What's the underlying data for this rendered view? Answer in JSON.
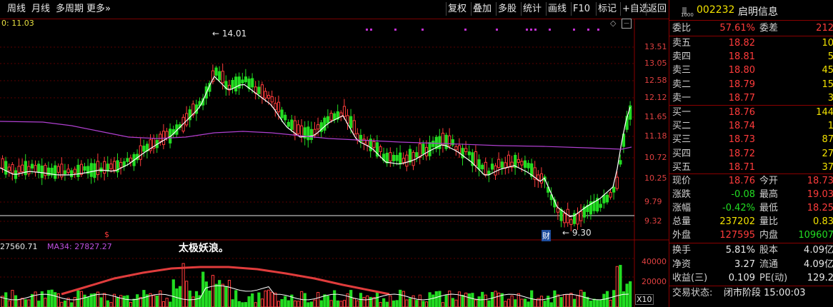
{
  "toolbar": {
    "left": [
      "周线",
      "月线",
      "多周期",
      "更多»"
    ],
    "right": [
      "复权",
      "叠加",
      "多股",
      "统计",
      "画线",
      "F10",
      "标记",
      "+自选",
      "返回"
    ]
  },
  "chart": {
    "top_left_label": "0: 11.03",
    "price_ticks": [
      "13.51",
      "13.05",
      "12.58",
      "12.12",
      "11.65",
      "11.18",
      "10.72",
      "10.25",
      "9.79",
      "9.32"
    ],
    "high_annotation": "14.01",
    "low_annotation": "9.30",
    "finance_marker": "财",
    "dollar_marker": "$",
    "volume_header": "27560.71",
    "ma34_label": "MA34: 27827.27",
    "note": "太极妖浪。",
    "volume_ticks": [
      "40000",
      "20000"
    ],
    "x_scale": "X10",
    "colors": {
      "up": "#ff3b3b",
      "down": "#22dd22",
      "ma_white": "#ffffff",
      "ma_purple": "#b040d0",
      "ma_red": "#e03c3c"
    }
  },
  "quote": {
    "code": "002232",
    "name": "启明信息",
    "weibi_label": "委比",
    "weibi_value": "57.61%",
    "weicha_label": "委差",
    "weicha_value": "212",
    "asks": [
      {
        "label": "卖五",
        "price": "18.82",
        "vol": "10"
      },
      {
        "label": "卖四",
        "price": "18.81",
        "vol": "5"
      },
      {
        "label": "卖三",
        "price": "18.80",
        "vol": "45"
      },
      {
        "label": "卖二",
        "price": "18.79",
        "vol": "15"
      },
      {
        "label": "卖一",
        "price": "18.77",
        "vol": "3"
      }
    ],
    "bids": [
      {
        "label": "买一",
        "price": "18.76",
        "vol": "144"
      },
      {
        "label": "买二",
        "price": "18.74",
        "vol": "1"
      },
      {
        "label": "买三",
        "price": "18.73",
        "vol": "87"
      },
      {
        "label": "买四",
        "price": "18.72",
        "vol": "27"
      },
      {
        "label": "买五",
        "price": "18.71",
        "vol": "37"
      }
    ],
    "stats": [
      {
        "l1": "现价",
        "v1": "18.76",
        "l2": "今开",
        "v2": "18.73"
      },
      {
        "l1": "涨跌",
        "v1": "-0.08",
        "l2": "最高",
        "v2": "19.03"
      },
      {
        "l1": "涨幅",
        "v1": "-0.42%",
        "l2": "最低",
        "v2": "18.25"
      },
      {
        "l1": "总量",
        "v1": "237202",
        "l2": "量比",
        "v2": "0.83"
      },
      {
        "l1": "外盘",
        "v1": "127595",
        "l2": "内盘",
        "v2": "109607"
      }
    ],
    "stats2": [
      {
        "l1": "换手",
        "v1": "5.81%",
        "l2": "股本",
        "v2": "4.09亿"
      },
      {
        "l1": "净资",
        "v1": "3.27",
        "l2": "流通",
        "v2": "4.09亿"
      },
      {
        "l1": "收益(三)",
        "v1": "0.109",
        "l2": "PE(动)",
        "v2": "129.2"
      }
    ],
    "trade_status_label": "交易状态:",
    "trade_status_value": "闭市阶段 15:00:03"
  }
}
